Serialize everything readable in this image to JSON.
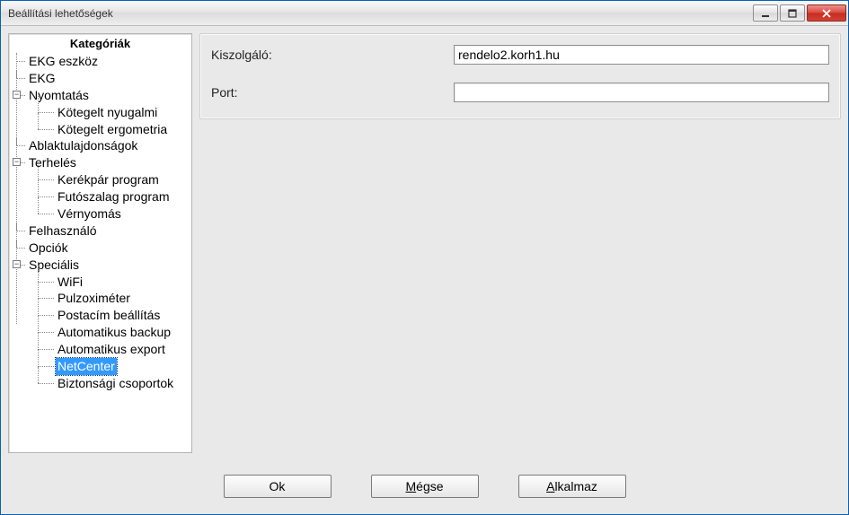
{
  "window": {
    "title": "Beállítási lehetőségek"
  },
  "sidebar": {
    "header": "Kategóriák",
    "items": {
      "ekg_eszkoz": "EKG eszköz",
      "ekg": "EKG",
      "nyomtatas": "Nyomtatás",
      "kotegelt_nyugalmi": "Kötegelt nyugalmi",
      "kotegelt_ergometria": "Kötegelt ergometria",
      "ablaktulajdonsagok": "Ablaktulajdonságok",
      "terheles": "Terhelés",
      "kerekpar_program": "Kerékpár program",
      "futoszalag_program": "Futószalag program",
      "vernyomas": "Vérnyomás",
      "felhasznalo": "Felhasználó",
      "opciok": "Opciók",
      "specialis": "Speciális",
      "wifi": "WiFi",
      "pulzoximeter": "Pulzoximéter",
      "postacim_beallitas": "Postacím beállítás",
      "automatikus_backup": "Automatikus backup",
      "automatikus_export": "Automatikus export",
      "netcenter": "NetCenter",
      "biztonsagi_csoportok": "Biztonsági csoportok"
    }
  },
  "form": {
    "server_label": "Kiszolgáló:",
    "server_value": "rendelo2.korh1.hu",
    "port_label": "Port:",
    "port_value": ""
  },
  "buttons": {
    "ok": "Ok",
    "cancel_prefix": "",
    "cancel_mn": "M",
    "cancel_suffix": "égse",
    "apply_prefix": "",
    "apply_mn": "A",
    "apply_suffix": "lkalmaz"
  },
  "expander_minus": "−"
}
